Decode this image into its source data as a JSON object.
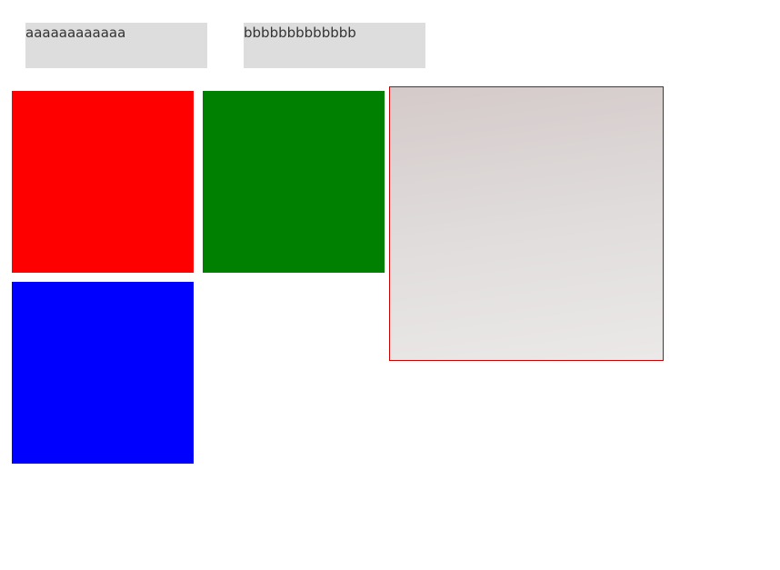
{
  "text_boxes": {
    "a": {
      "text": "aaaaaaaaaaaa"
    },
    "b": {
      "text": "bbbbbbbbbbbbb"
    }
  },
  "tiles": [
    {
      "name": "red",
      "color": "#ff0000"
    },
    {
      "name": "green",
      "color": "#008000"
    },
    {
      "name": "blue",
      "color": "#0000ff"
    }
  ],
  "drop_zone": {
    "border_color": "#cc0000"
  }
}
